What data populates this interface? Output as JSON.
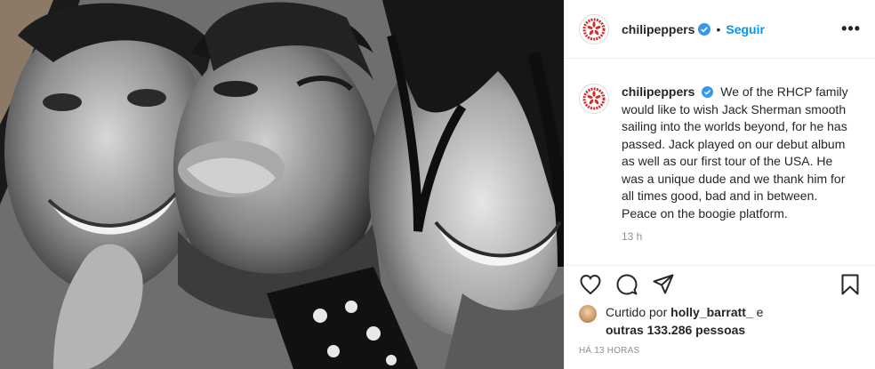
{
  "post": {
    "username": "chilipeppers",
    "follow_label": "Seguir",
    "separator": "•",
    "more_label": "•••",
    "avatar_text": "RED HOT CHILI PEPPERS",
    "caption": "We of the RHCP family would like to wish Jack Sherman smooth sailing into the worlds beyond, for he has passed. Jack played on our debut album as well as our first tour of the USA. He was a unique dude and we thank him for all times good, bad and in between. Peace on the boogie platform.",
    "caption_time": "13 h",
    "liked_prefix": "Curtido por",
    "liked_by": "holly_barratt_",
    "liked_and": "e",
    "liked_others": "outras 133.286 pessoas",
    "time_ago": "HÁ 13 HORAS"
  },
  "icons": {
    "verified": "verified-badge-icon",
    "like": "heart-icon",
    "comment": "comment-icon",
    "share": "paper-plane-icon",
    "save": "bookmark-icon"
  },
  "colors": {
    "link": "#0095f6",
    "secondary_text": "#8e8e8e",
    "logo_red": "#d62828"
  }
}
